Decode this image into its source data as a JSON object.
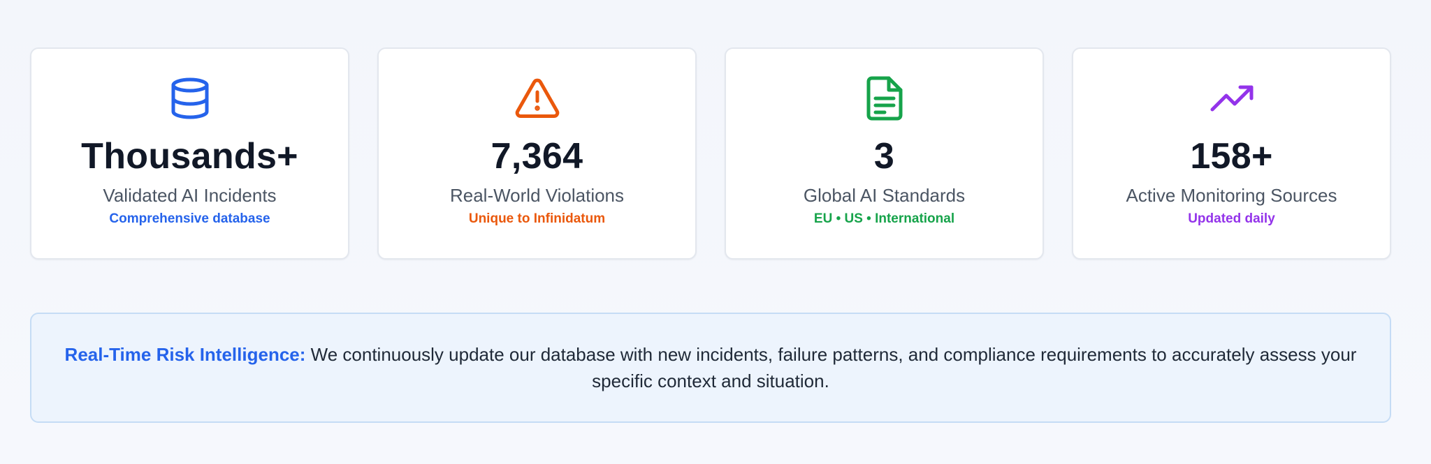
{
  "stats": [
    {
      "icon": "database-icon",
      "value": "Thousands+",
      "label": "Validated AI Incidents",
      "sub": "Comprehensive database",
      "accent": "#2563eb"
    },
    {
      "icon": "warning-triangle-icon",
      "value": "7,364",
      "label": "Real-World Violations",
      "sub": "Unique to Infinidatum",
      "accent": "#ea580c"
    },
    {
      "icon": "document-icon",
      "value": "3",
      "label": "Global AI Standards",
      "sub": "EU • US • International",
      "accent": "#16a34a"
    },
    {
      "icon": "trending-up-icon",
      "value": "158+",
      "label": "Active Monitoring Sources",
      "sub": "Updated daily",
      "accent": "#9333ea"
    }
  ],
  "banner": {
    "lead": "Real-Time Risk Intelligence:",
    "text": "We continuously update our database with new incidents, failure patterns, and compliance requirements to accurately assess your specific context and situation.",
    "accent": "#2563eb"
  }
}
